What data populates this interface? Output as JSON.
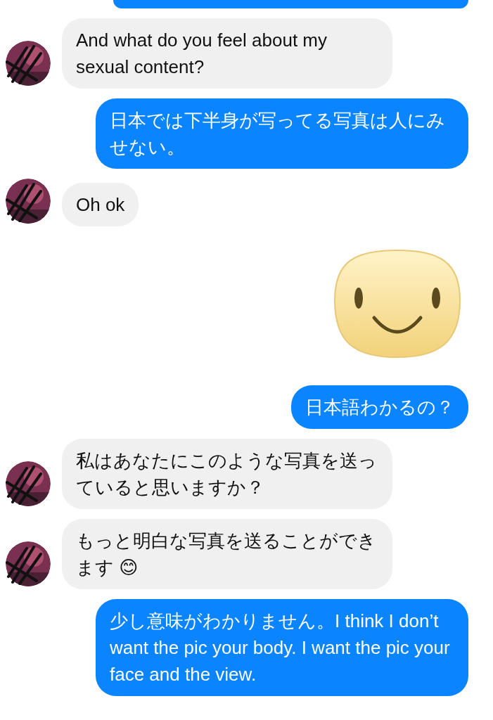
{
  "messages": [
    {
      "outgoing": true,
      "kind": "clipped"
    },
    {
      "outgoing": false,
      "kind": "text",
      "text": "And what do you feel about my sexual content?"
    },
    {
      "outgoing": true,
      "kind": "text",
      "text": "日本では下半身が写ってる写真は人にみせない。"
    },
    {
      "outgoing": false,
      "kind": "text",
      "text": "Oh ok"
    },
    {
      "outgoing": true,
      "kind": "sticker"
    },
    {
      "outgoing": true,
      "kind": "text",
      "text": "日本語わかるの？"
    },
    {
      "outgoing": false,
      "kind": "text",
      "text": "私はあなたにこのような写真を送っていると思いますか？"
    },
    {
      "outgoing": false,
      "kind": "text",
      "text": "もっと明白な写真を送ることができます 😊"
    },
    {
      "outgoing": true,
      "kind": "text",
      "text": "少し意味がわかりません。I think I don’t want the pic your body. I want the pic your face and the view."
    }
  ]
}
